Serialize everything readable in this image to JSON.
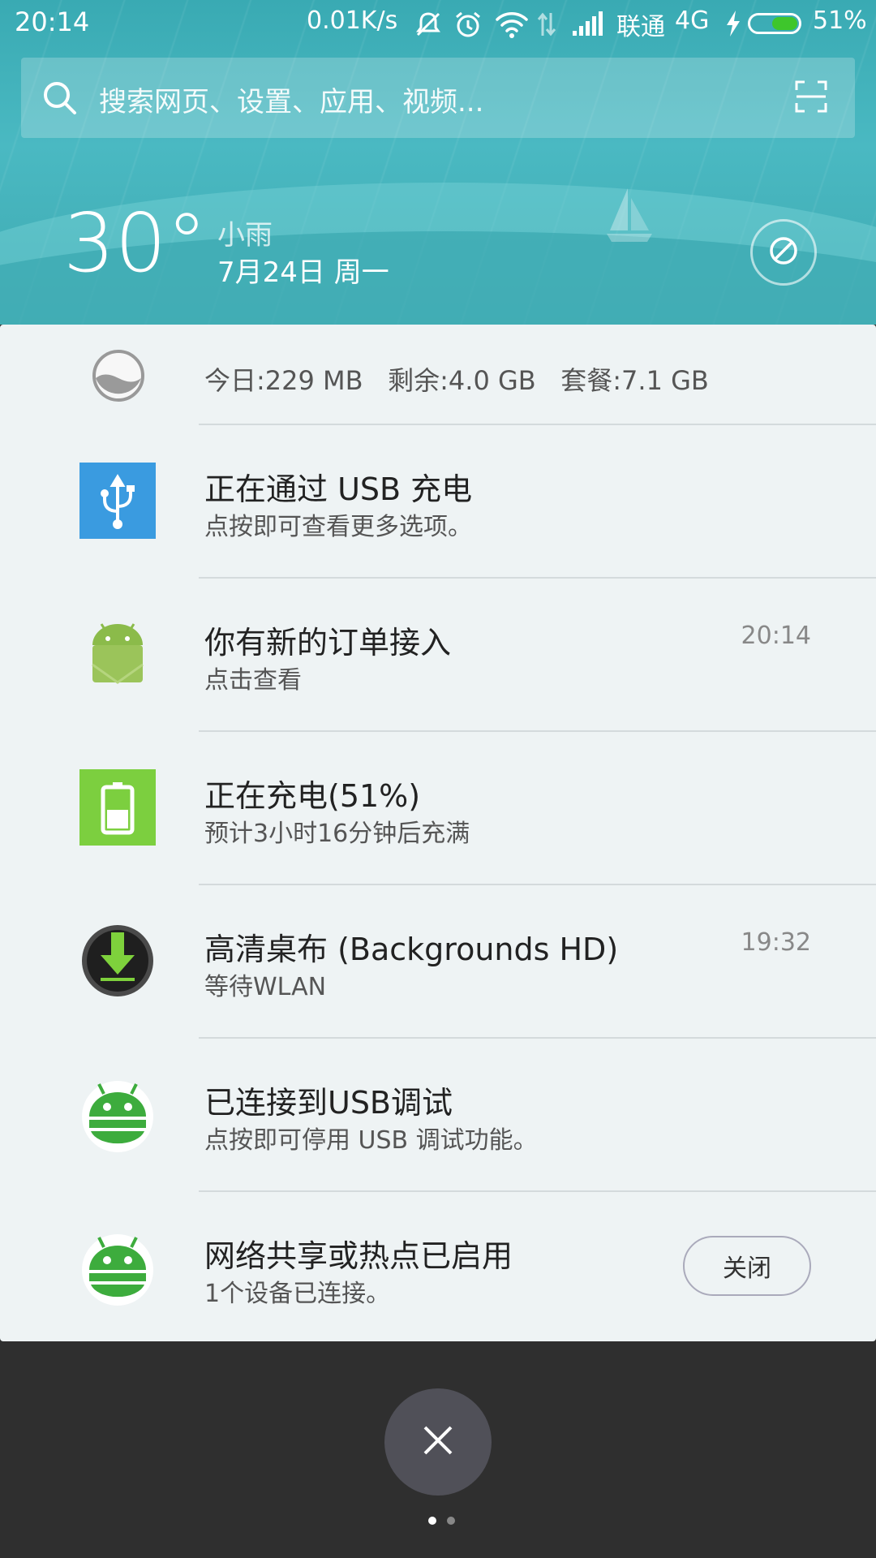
{
  "status_bar": {
    "time": "20:14",
    "net_speed": "0.01K/s",
    "carrier": "联通",
    "network": "4G",
    "battery_percent": "51%",
    "battery_level": 0.51,
    "icons": [
      "mute-icon",
      "alarm-icon",
      "wifi-icon",
      "data-arrows-icon",
      "signal-icon",
      "charging-bolt-icon"
    ]
  },
  "search": {
    "placeholder": "搜索网页、设置、应用、视频..."
  },
  "weather": {
    "temperature": "30°",
    "condition": "小雨",
    "date": "7月24日 周一"
  },
  "data_usage": {
    "today": "今日:229 MB",
    "remaining": "剩余:4.0 GB",
    "plan": "套餐:7.1 GB"
  },
  "notifications": [
    {
      "icon": "usb-icon",
      "title": "正在通过 USB 充电",
      "subtitle": "点按即可查看更多选项。",
      "time": ""
    },
    {
      "icon": "android-app-icon",
      "title": "你有新的订单接入",
      "subtitle": "点击查看",
      "time": "20:14"
    },
    {
      "icon": "battery-charging-icon",
      "title": "正在充电(51%)",
      "subtitle": "预计3小时16分钟后充满",
      "time": ""
    },
    {
      "icon": "download-icon",
      "title": "高清桌布 (Backgrounds HD)",
      "subtitle": "等待WLAN",
      "time": "19:32"
    },
    {
      "icon": "android-debug-icon",
      "title": "已连接到USB调试",
      "subtitle": "点按即可停用 USB 调试功能。",
      "time": ""
    },
    {
      "icon": "android-hotspot-icon",
      "title": "网络共享或热点已启用",
      "subtitle": "1个设备已连接。",
      "time": "",
      "action": "关闭"
    }
  ],
  "colors": {
    "header": "#3fb0b8",
    "panel": "#eef3f4",
    "usb_icon_bg": "#3a9be0",
    "battery_icon_bg": "#7ccf3f",
    "android_green": "#3dac3d"
  },
  "pager": {
    "pages": 2,
    "current": 1
  }
}
